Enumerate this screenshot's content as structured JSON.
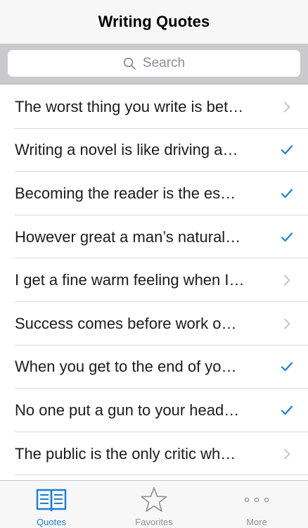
{
  "navbar": {
    "title": "Writing Quotes"
  },
  "search": {
    "placeholder": "Search",
    "icon": "magnifying-glass-icon"
  },
  "quotes": [
    {
      "text": "The worst thing you write is bet…",
      "accessory": "chevron"
    },
    {
      "text": "Writing a novel is like driving a…",
      "accessory": "checkmark"
    },
    {
      "text": "Becoming the reader is the es…",
      "accessory": "checkmark"
    },
    {
      "text": "However great a man’s natural…",
      "accessory": "checkmark"
    },
    {
      "text": "I get a fine warm feeling when I…",
      "accessory": "chevron"
    },
    {
      "text": "Success comes before work o…",
      "accessory": "chevron"
    },
    {
      "text": "When you get to the end of yo…",
      "accessory": "checkmark"
    },
    {
      "text": "No one put a gun to your head…",
      "accessory": "checkmark"
    },
    {
      "text": "The public is the only critic wh…",
      "accessory": "chevron"
    }
  ],
  "tabbar": {
    "tabs": [
      {
        "label": "Quotes",
        "icon": "book-icon",
        "active": true
      },
      {
        "label": "Favorites",
        "icon": "star-icon",
        "active": false
      },
      {
        "label": "More",
        "icon": "more-dots-icon",
        "active": false
      }
    ]
  },
  "colors": {
    "accent": "#1b7fd6",
    "inactive_tab": "#929292",
    "chevron": "#c7c7cc",
    "navbar_bg": "#f7f7f7",
    "searchbar_bg": "#c9c9ce"
  }
}
